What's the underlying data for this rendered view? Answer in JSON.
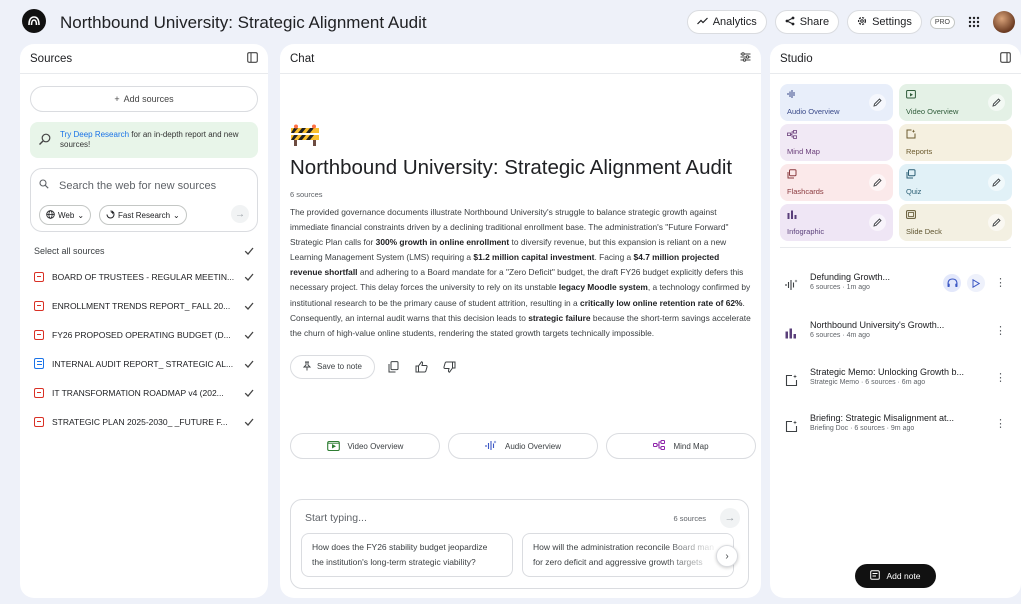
{
  "header": {
    "title": "Northbound University: Strategic Alignment Audit",
    "analytics_label": "Analytics",
    "share_label": "Share",
    "settings_label": "Settings",
    "pro_label": "PRO"
  },
  "sources": {
    "heading": "Sources",
    "add_label": "Add sources",
    "deep_research_link": "Try Deep Research",
    "deep_research_rest": " for an in-depth report and new sources!",
    "search_placeholder": "Search the web for new sources",
    "chip_web": "Web",
    "chip_research": "Fast Research",
    "select_all": "Select all sources",
    "items": [
      {
        "title": "BOARD OF TRUSTEES - REGULAR MEETIN...",
        "type": "pdf"
      },
      {
        "title": "ENROLLMENT TRENDS REPORT_ FALL 20...",
        "type": "pdf"
      },
      {
        "title": "FY26 PROPOSED OPERATING BUDGET (D...",
        "type": "pdf"
      },
      {
        "title": "INTERNAL AUDIT REPORT_ STRATEGIC AL...",
        "type": "doc"
      },
      {
        "title": "IT TRANSFORMATION ROADMAP v4 (202...",
        "type": "pdf"
      },
      {
        "title": "STRATEGIC PLAN 2025-2030_ _FUTURE F...",
        "type": "pdf"
      }
    ]
  },
  "chat": {
    "heading": "Chat",
    "title": "Northbound University: Strategic Alignment Audit",
    "source_count": "6 sources",
    "summary": {
      "p1": "The provided governance documents illustrate Northbound University's struggle to balance strategic growth against immediate financial constraints driven by a declining traditional enrollment base. The administration's \"Future Forward\" Strategic Plan calls for ",
      "b1": "300% growth in online enrollment",
      "p2": " to diversify revenue, but this expansion is reliant on a new Learning Management System (LMS) requiring a ",
      "b2": "$1.2 million capital investment",
      "p3": ". Facing a ",
      "b3": "$4.7 million projected revenue shortfall",
      "p4": " and adhering to a Board mandate for a \"Zero Deficit\" budget, the draft FY26 budget explicitly defers this necessary project. This delay forces the university to rely on its unstable ",
      "b4": "legacy Moodle system",
      "p5": ", a technology confirmed by institutional research to be the primary cause of student attrition, resulting in a ",
      "b5": "critically low online retention rate of 62%",
      "p6": ". Consequently, an internal audit warns that this decision leads to ",
      "b6": "strategic failure",
      "p7": " because the short-term savings accelerate the churn of high-value online students, rendering the stated growth targets technically impossible."
    },
    "save_note_label": "Save to note",
    "quick": {
      "video": "Video Overview",
      "audio": "Audio Overview",
      "mindmap": "Mind Map"
    },
    "composer_placeholder": "Start typing...",
    "composer_count": "6 sources",
    "suggestions": [
      {
        "line1": "How does the FY26 stability budget jeopardize",
        "line2": "the institution's long-term strategic viability?"
      },
      {
        "line1": "How will the administration reconcile Board man",
        "line2": "for zero deficit and aggressive growth targets"
      }
    ]
  },
  "studio": {
    "heading": "Studio",
    "tiles": [
      {
        "label": "Audio Overview",
        "bg": "#e8eefa",
        "fg": "#3b4b8a",
        "edit": true
      },
      {
        "label": "Video Overview",
        "bg": "#e4f1e6",
        "fg": "#2f5b3a",
        "edit": true
      },
      {
        "label": "Mind Map",
        "bg": "#f1e9f5",
        "fg": "#6a3f7a",
        "edit": false
      },
      {
        "label": "Reports",
        "bg": "#f5f0e0",
        "fg": "#6b5a2e",
        "edit": false
      },
      {
        "label": "Flashcards",
        "bg": "#fbe9ea",
        "fg": "#8a3a3f",
        "edit": true
      },
      {
        "label": "Quiz",
        "bg": "#e1f1f7",
        "fg": "#2b5e74",
        "edit": true
      },
      {
        "label": "Infographic",
        "bg": "#efe6f5",
        "fg": "#5a3f7a",
        "edit": true
      },
      {
        "label": "Slide Deck",
        "bg": "#f3f0e2",
        "fg": "#5f5530",
        "edit": true
      }
    ],
    "notes": [
      {
        "title": "Defunding Growth...",
        "meta": "6 sources · 1m ago",
        "kind": "audio"
      },
      {
        "title": "Northbound University's Growth...",
        "meta": "6 sources · 4m ago",
        "kind": "infographic"
      },
      {
        "title": "Strategic Memo: Unlocking Growth b...",
        "meta": "Strategic Memo · 6 sources · 6m ago",
        "kind": "report"
      },
      {
        "title": "Briefing: Strategic Misalignment at...",
        "meta": "Briefing Doc · 6 sources · 9m ago",
        "kind": "report"
      }
    ],
    "add_note_label": "Add note"
  }
}
